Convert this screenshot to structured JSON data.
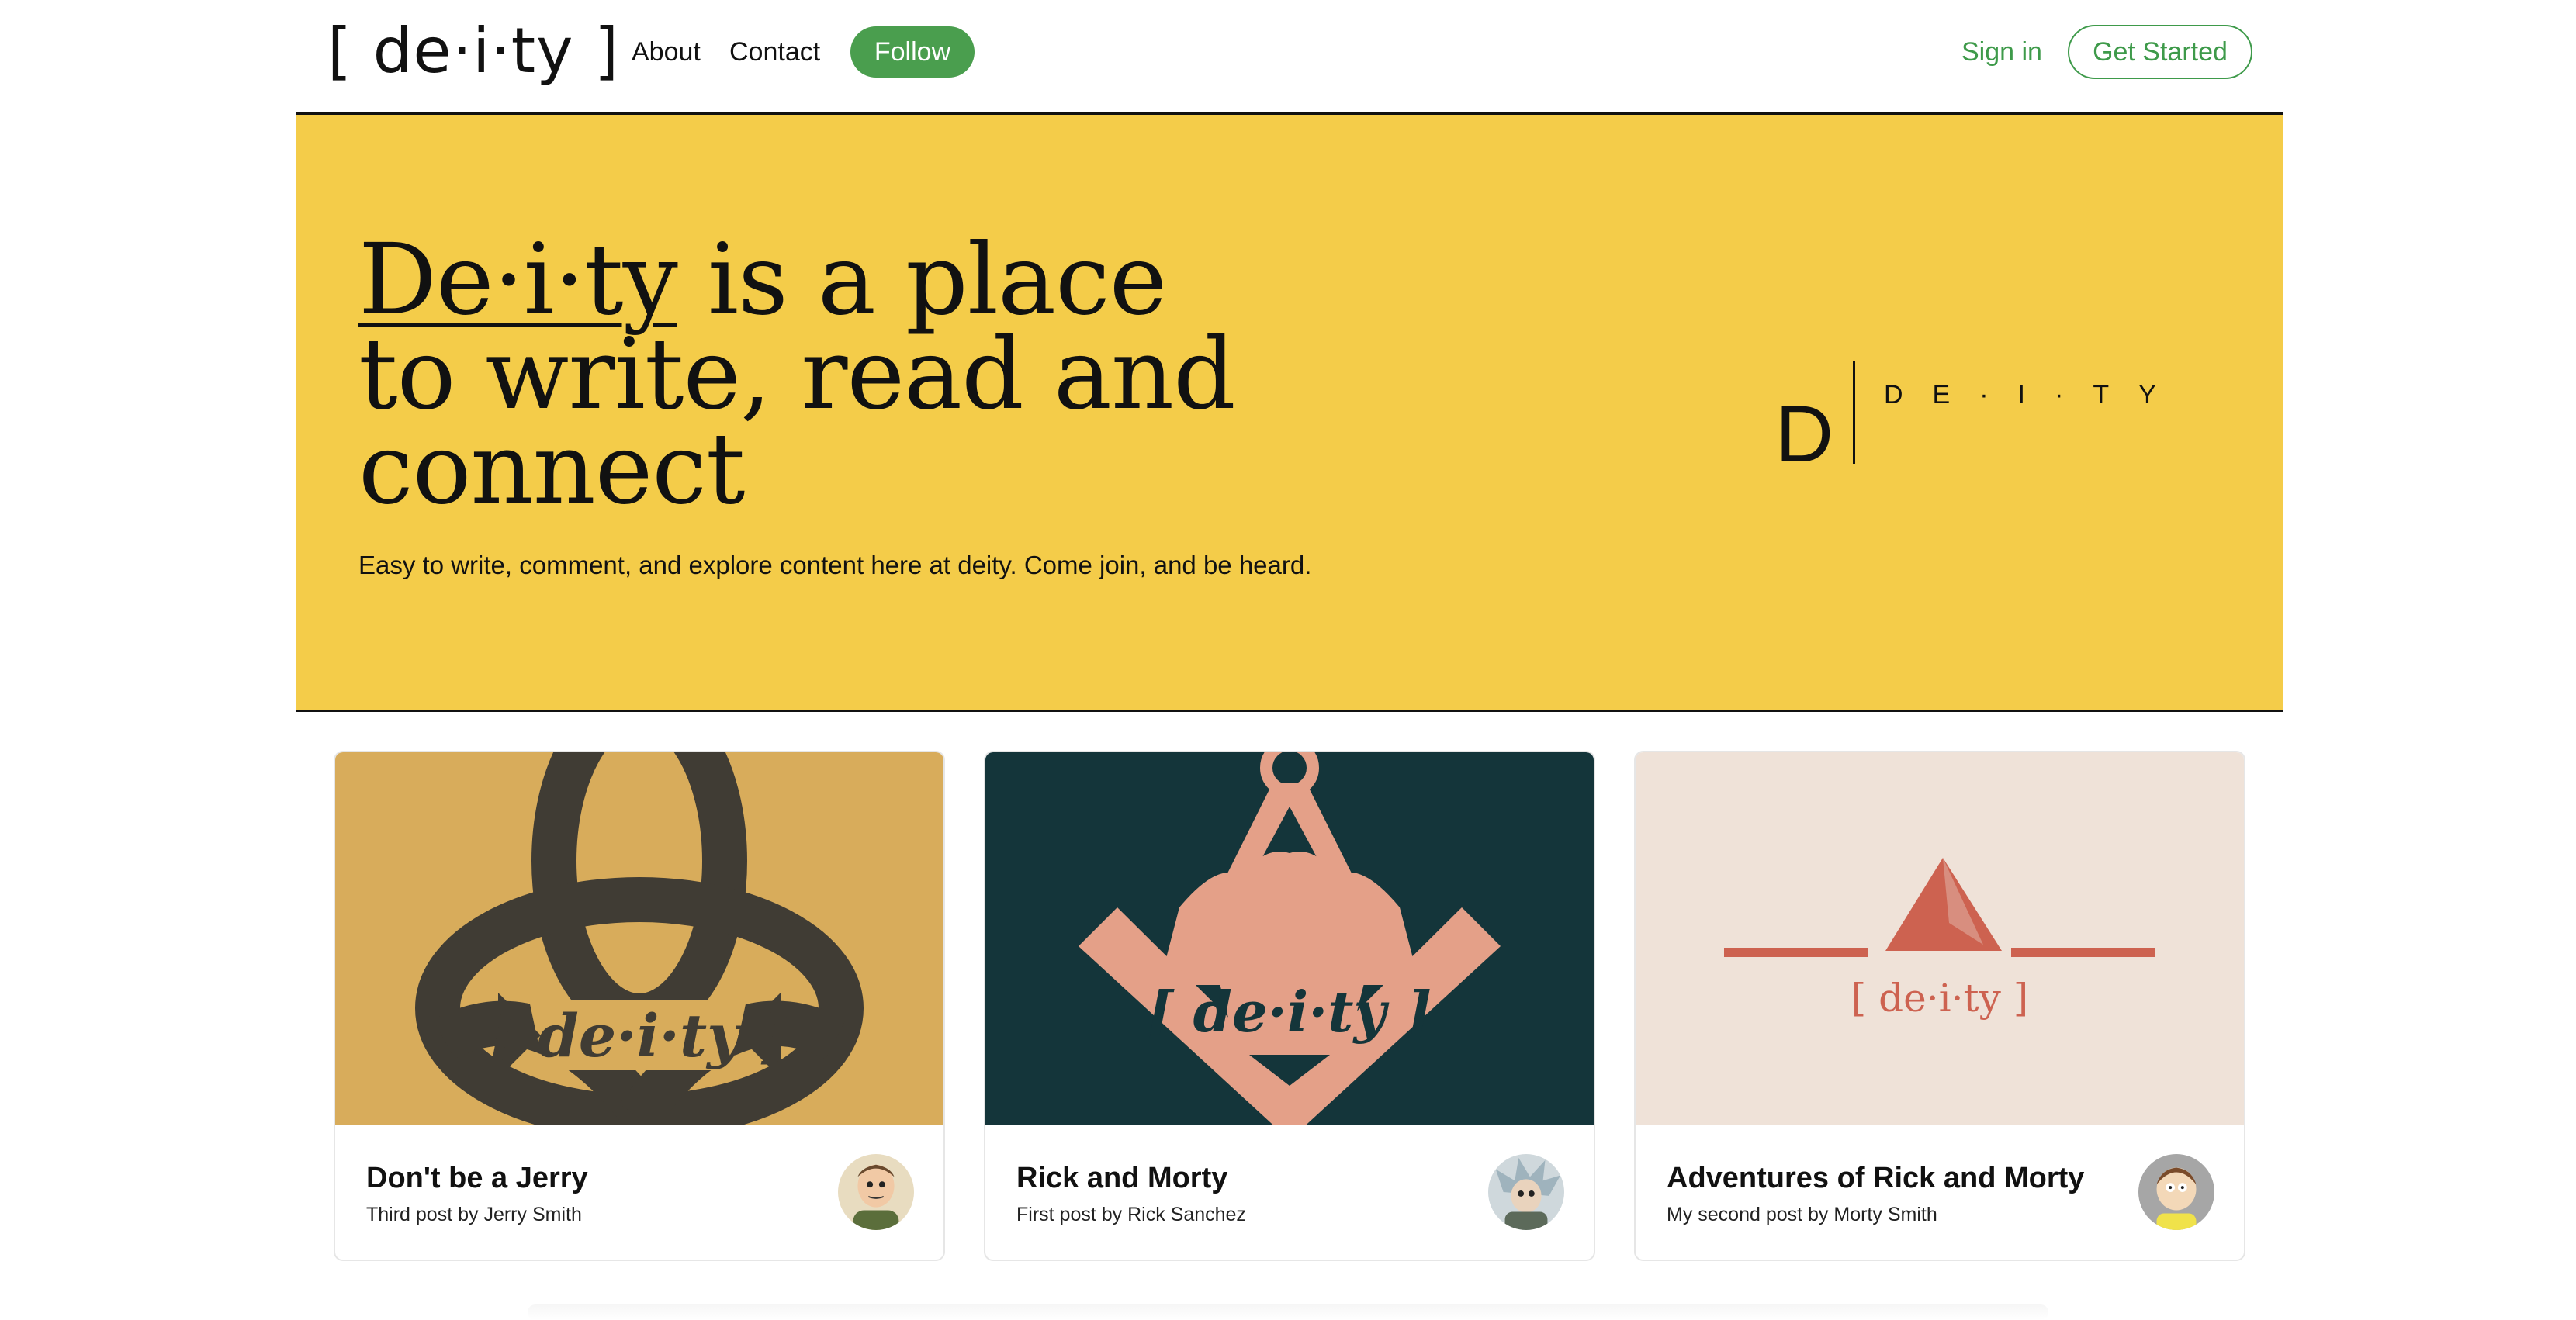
{
  "nav": {
    "logo": "[ de·i·ty ]",
    "about": "About",
    "contact": "Contact",
    "follow": "Follow",
    "sign_in": "Sign in",
    "get_started": "Get Started"
  },
  "hero": {
    "brand": "De·i·ty",
    "title_rest": " is a place to write, read and connect",
    "subtitle": "Easy to write, comment, and explore content here at deity. Come join, and be heard.",
    "mark_letter": "D",
    "mark_word": "DE·I·TY"
  },
  "cards": [
    {
      "title": "Don't be a Jerry",
      "meta": "Third post by Jerry Smith",
      "image_text": "[ de·i·ty ]",
      "image_bg": "#d8ac5b"
    },
    {
      "title": "Rick and Morty",
      "meta": "First post by Rick Sanchez",
      "image_text": "[ de·i·ty ]",
      "image_bg": "#14353a"
    },
    {
      "title": "Adventures of Rick and Morty",
      "meta": "My second post by Morty Smith",
      "image_text": "[ de·i·ty ]",
      "image_bg": "#efe2d8"
    }
  ],
  "colors": {
    "accent_green": "#4a9e4e",
    "hero_yellow": "#f4cc49"
  }
}
